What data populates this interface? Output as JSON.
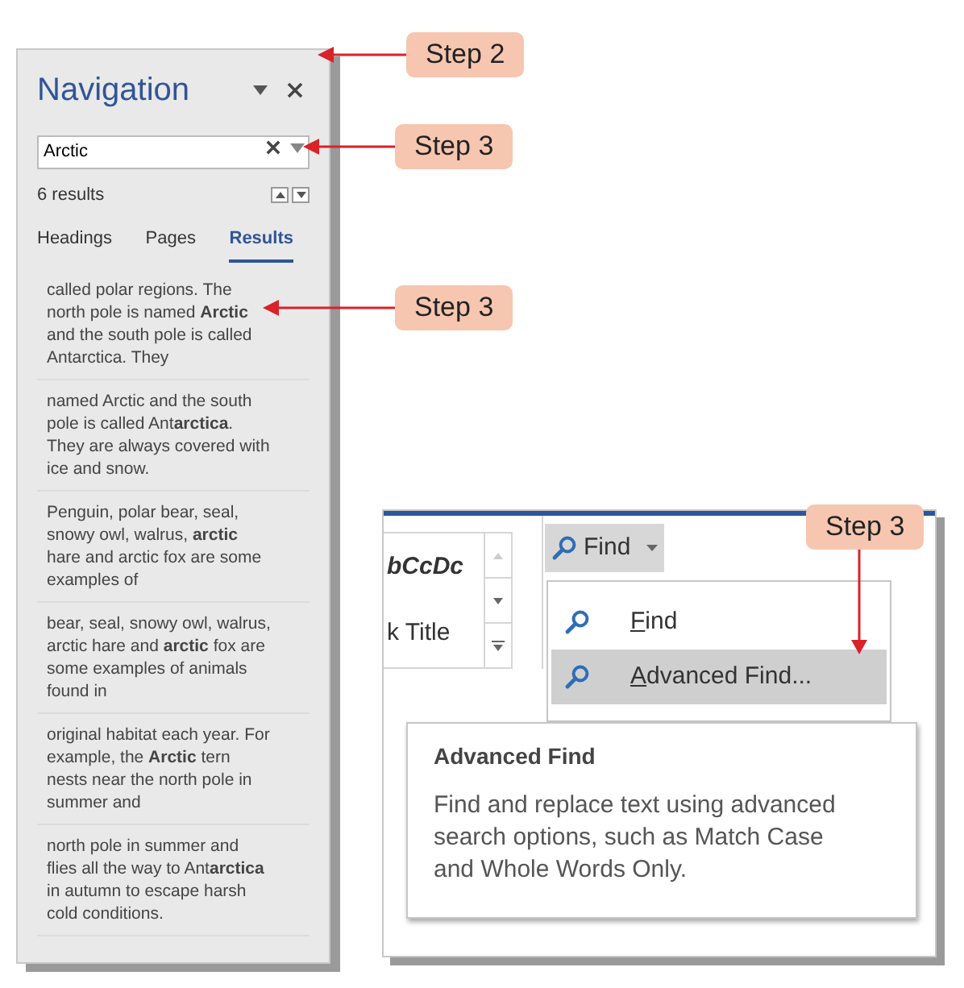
{
  "navigation": {
    "title": "Navigation",
    "search": {
      "value": "Arctic"
    },
    "result_count": "6 results",
    "tabs": [
      {
        "label": "Headings",
        "selected": false
      },
      {
        "label": "Pages",
        "selected": false
      },
      {
        "label": "Results",
        "selected": true
      }
    ],
    "results": [
      {
        "text": "called polar regions. The north pole is named **Arctic** and the south pole is called Antarctica. They"
      },
      {
        "text": "named Arctic and the south pole is called Ant**arctica**. They are always covered with ice and snow."
      },
      {
        "text": "Penguin, polar bear, seal, snowy owl, walrus, **arctic** hare and arctic fox are some examples of"
      },
      {
        "text": "bear, seal, snowy owl, walrus, arctic hare and **arctic** fox are some examples of animals found in"
      },
      {
        "text": "original habitat each year. For example, the **Arctic** tern nests near the north pole in summer and"
      },
      {
        "text": "north pole in summer and flies all the way to Ant**arctica** in autumn to escape harsh cold conditions."
      }
    ]
  },
  "ribbon": {
    "style_samples": [
      "bCcDc",
      "k Title"
    ],
    "find_button": "Find",
    "menu": [
      {
        "underlined": "F",
        "rest": "ind",
        "selected": false
      },
      {
        "underlined": "A",
        "rest": "dvanced Find...",
        "selected": true
      }
    ],
    "tooltip": {
      "title": "Advanced Find",
      "body": "Find and replace text using advanced search options, such as Match Case and Whole Words Only."
    }
  },
  "callouts": [
    {
      "label": "Step 2"
    },
    {
      "label": "Step 3"
    },
    {
      "label": "Step 3"
    },
    {
      "label": "Step 3"
    }
  ]
}
